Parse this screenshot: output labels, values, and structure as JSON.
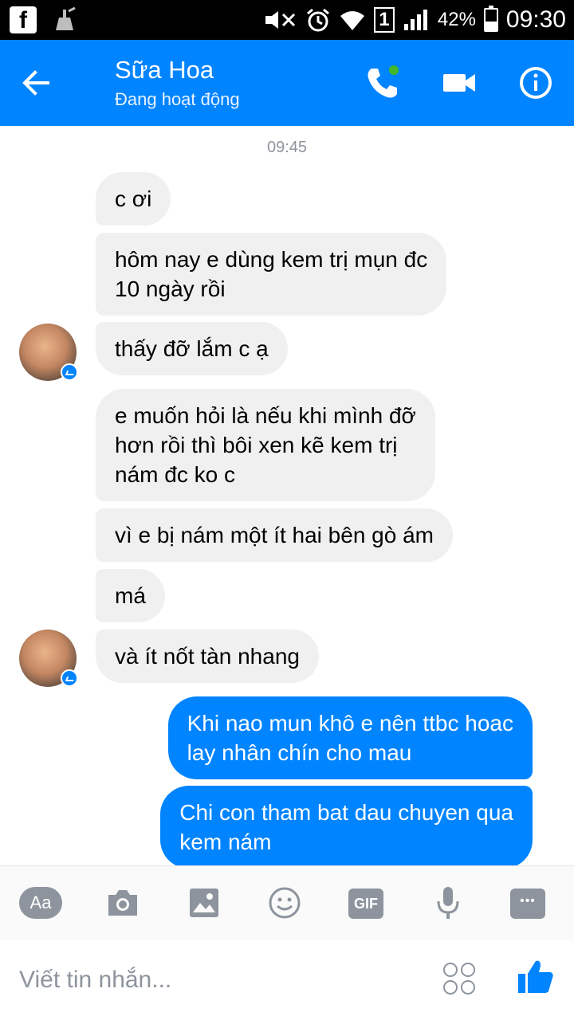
{
  "status_bar": {
    "battery": "42%",
    "time": "09:30",
    "sim_indicator": "1",
    "battery_level": 0.42
  },
  "header": {
    "contact_name": "Sữa Hoa",
    "contact_status": "Đang hoạt động",
    "accent_color": "#0084ff",
    "icons": [
      "back-arrow-icon",
      "phone-call-icon",
      "video-camera-icon",
      "info-icon"
    ]
  },
  "chat": {
    "timestamp": "09:45",
    "messages": [
      {
        "sender": "contact",
        "text": "c ơi"
      },
      {
        "sender": "contact",
        "text": "hôm nay  e dùng kem trị mụn đc\n10 ngày rồi"
      },
      {
        "sender": "contact",
        "text": "thấy đỡ lắm c ạ"
      },
      {
        "sender": "contact",
        "text": "e muốn hỏi là nếu khi mình đỡ\nhơn rồi thì bôi xen kẽ kem trị\nnám đc ko c"
      },
      {
        "sender": "contact",
        "text": "vì e bị nám một ít hai bên gò ám"
      },
      {
        "sender": "contact",
        "text": "má"
      },
      {
        "sender": "contact",
        "text": "và ít nốt tàn nhang"
      },
      {
        "sender": "me",
        "text": "Khi nao mun khô e nên ttbc hoac\nlay nhân chín cho mau"
      },
      {
        "sender": "me",
        "text": "Chi con tham bat dau chuyen qua\nkem nám"
      }
    ]
  },
  "toolbar": {
    "text_button": "Aa",
    "gif_button": "GIF",
    "icons": [
      "text-style-icon",
      "camera-icon",
      "image-icon",
      "emoji-icon",
      "gif-icon",
      "microphone-icon",
      "more-icon"
    ]
  },
  "compose": {
    "placeholder": "Viết tin nhắn...",
    "icons": [
      "sticker-icon",
      "thumbs-up-icon"
    ]
  }
}
